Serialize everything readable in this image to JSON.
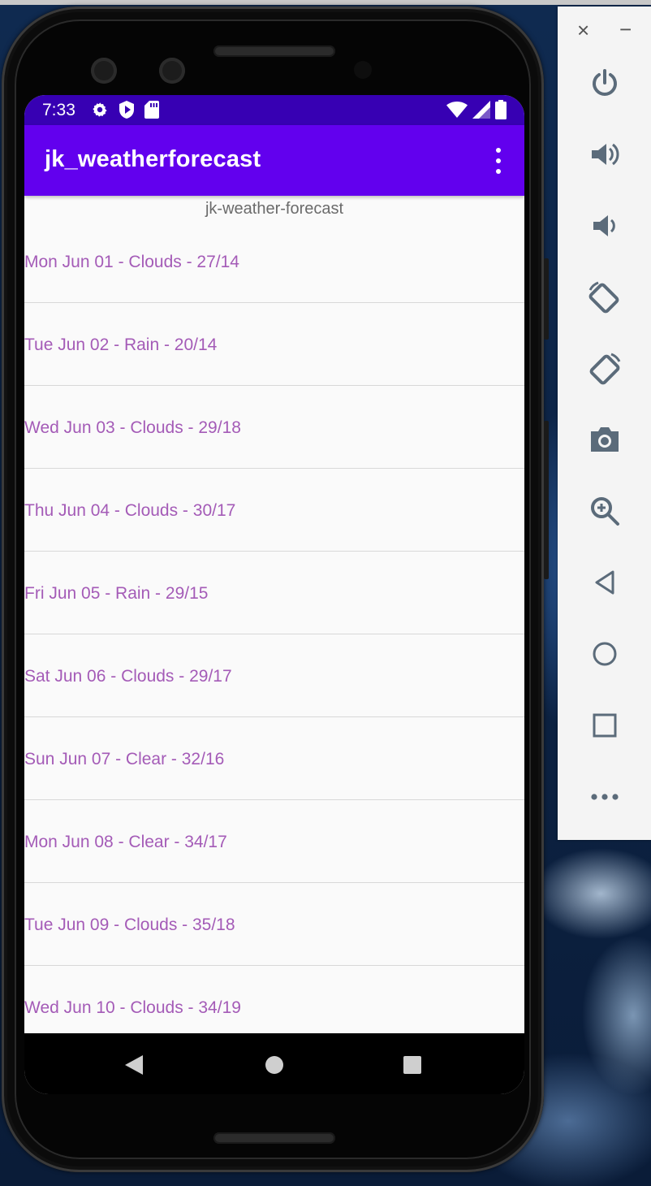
{
  "status_bar": {
    "time": "7:33",
    "icons_left": [
      "gear-icon",
      "shield-play-icon",
      "sd-card-icon"
    ],
    "icons_right": [
      "wifi-icon",
      "cell-signal-icon",
      "battery-icon"
    ],
    "color": "#3700b3"
  },
  "app_bar": {
    "title": "jk_weatherforecast",
    "color": "#6200ee",
    "menu_icon": "more-vert-icon"
  },
  "subtitle": "jk-weather-forecast",
  "forecast": [
    "Mon Jun 01 - Clouds - 27/14",
    "Tue Jun 02 - Rain - 20/14",
    "Wed Jun 03 - Clouds - 29/18",
    "Thu Jun 04 - Clouds - 30/17",
    "Fri Jun 05 - Rain - 29/15",
    "Sat Jun 06 - Clouds - 29/17",
    "Sun Jun 07 - Clear - 32/16",
    "Mon Jun 08 - Clear - 34/17",
    "Tue Jun 09 - Clouds - 35/18",
    "Wed Jun 10 - Clouds - 34/19"
  ],
  "list_text_color": "#a45bb7",
  "nav_bar": {
    "buttons": [
      "back-icon",
      "home-icon",
      "recents-icon"
    ]
  },
  "emulator_toolbar": {
    "window_controls": {
      "close": "×",
      "minimize": "−"
    },
    "buttons": [
      "power-icon",
      "volume-up-icon",
      "volume-down-icon",
      "rotate-left-icon",
      "rotate-right-icon",
      "camera-icon",
      "zoom-icon",
      "back-icon",
      "home-icon",
      "overview-icon",
      "more-icon"
    ]
  }
}
